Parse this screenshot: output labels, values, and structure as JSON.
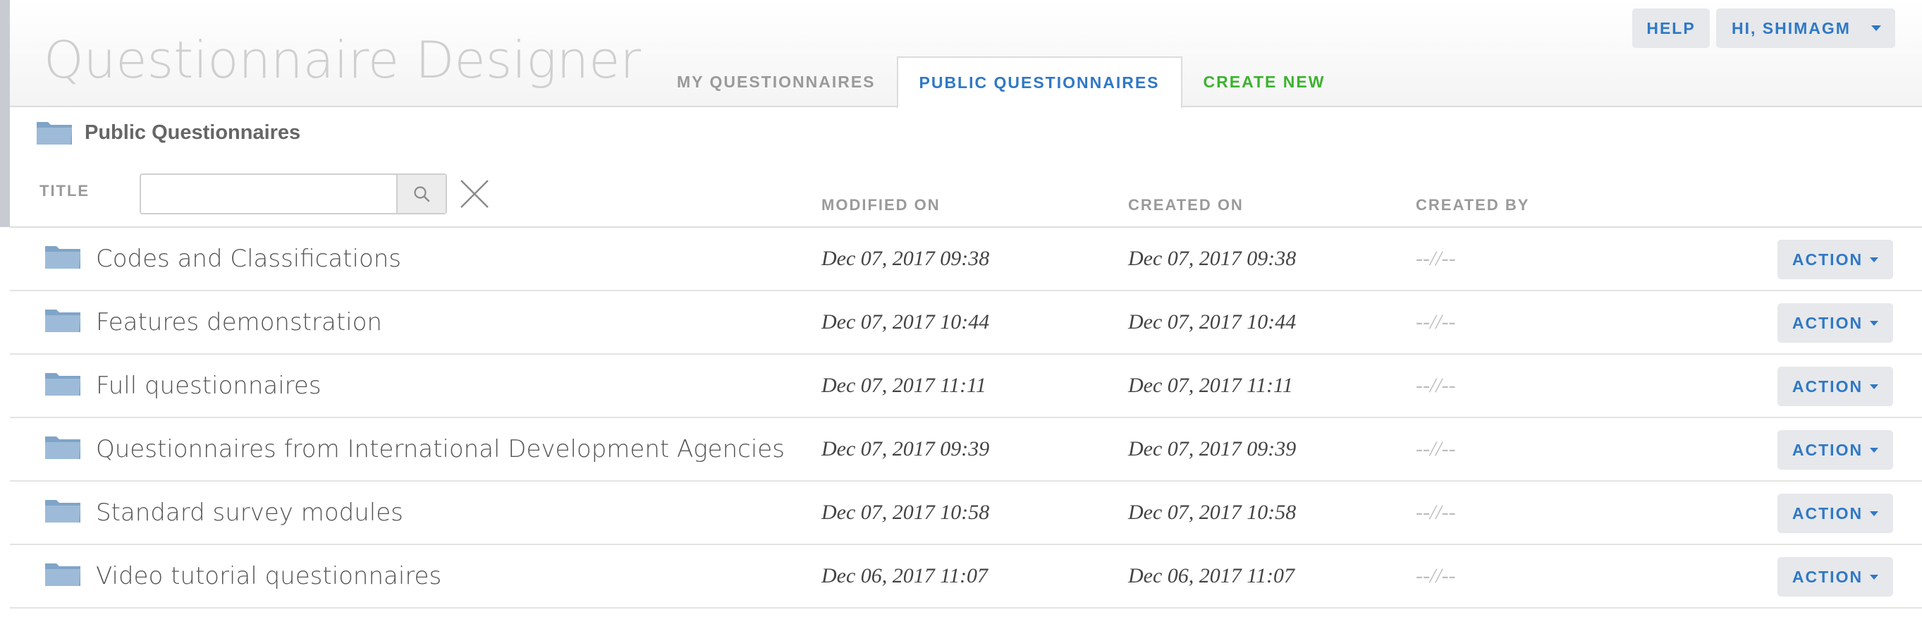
{
  "app": {
    "title": "Questionnaire Designer"
  },
  "tabs": [
    {
      "label": "MY QUESTIONNAIRES"
    },
    {
      "label": "PUBLIC QUESTIONNAIRES",
      "active": true
    },
    {
      "label": "CREATE NEW"
    }
  ],
  "user_menu": {
    "help_label": "HELP",
    "user_label": "HI, SHIMAGM"
  },
  "breadcrumb": {
    "label": "Public Questionnaires",
    "icon": "folder-icon"
  },
  "filter": {
    "title_label": "TITLE",
    "search_value": "",
    "search_placeholder": ""
  },
  "columns": {
    "modified": "MODIFIED ON",
    "created": "CREATED ON",
    "created_by": "CREATED BY"
  },
  "rows": [
    {
      "title": "Codes and Classifications",
      "modified": "Dec 07, 2017 09:38",
      "created": "Dec 07, 2017 09:38",
      "created_by": "--//--",
      "action": "ACTION"
    },
    {
      "title": "Features demonstration",
      "modified": "Dec 07, 2017 10:44",
      "created": "Dec 07, 2017 10:44",
      "created_by": "--//--",
      "action": "ACTION"
    },
    {
      "title": "Full questionnaires",
      "modified": "Dec 07, 2017 11:11",
      "created": "Dec 07, 2017 11:11",
      "created_by": "--//--",
      "action": "ACTION"
    },
    {
      "title": "Questionnaires from International Development Agencies",
      "modified": "Dec 07, 2017 09:39",
      "created": "Dec 07, 2017 09:39",
      "created_by": "--//--",
      "action": "ACTION"
    },
    {
      "title": "Standard survey modules",
      "modified": "Dec 07, 2017 10:58",
      "created": "Dec 07, 2017 10:58",
      "created_by": "--//--",
      "action": "ACTION"
    },
    {
      "title": "Video tutorial questionnaires",
      "modified": "Dec 06, 2017 11:07",
      "created": "Dec 06, 2017 11:07",
      "created_by": "--//--",
      "action": "ACTION"
    }
  ],
  "colors": {
    "accent": "#2f78c6",
    "create": "#3cb32e",
    "folder": "#8fb0cf"
  }
}
